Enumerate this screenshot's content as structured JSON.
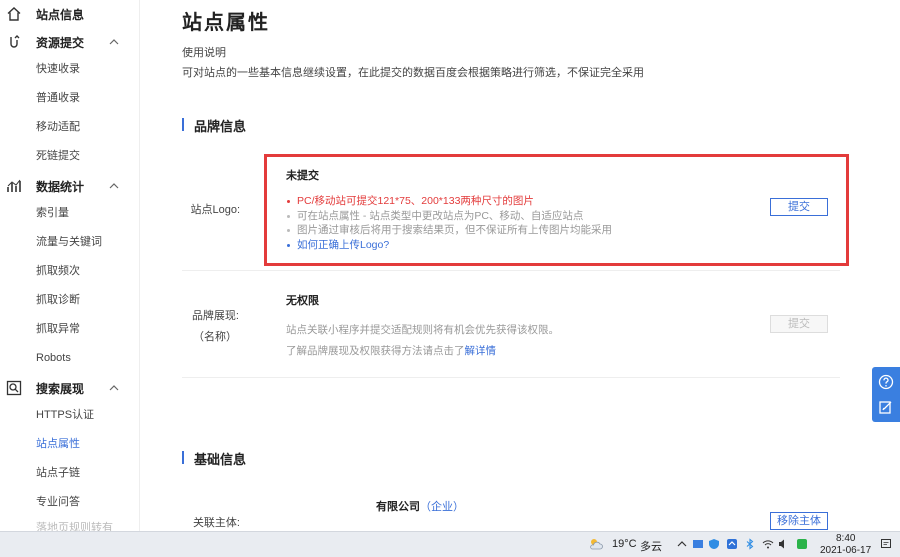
{
  "sidebar": {
    "groups": [
      {
        "label": "站点信息",
        "icon": "home-icon"
      },
      {
        "label": "资源提交",
        "icon": "submit-icon"
      },
      {
        "label": "数据统计",
        "icon": "stats-icon"
      },
      {
        "label": "搜索展现",
        "icon": "search-display-icon"
      }
    ],
    "items": [
      {
        "label": "快速收录"
      },
      {
        "label": "普通收录"
      },
      {
        "label": "移动适配"
      },
      {
        "label": "死链提交"
      },
      {
        "label": "索引量"
      },
      {
        "label": "流量与关键词"
      },
      {
        "label": "抓取频次"
      },
      {
        "label": "抓取诊断"
      },
      {
        "label": "抓取异常"
      },
      {
        "label": "Robots"
      },
      {
        "label": "HTTPS认证"
      },
      {
        "label": "站点属性"
      },
      {
        "label": "站点子链"
      },
      {
        "label": "专业问答"
      },
      {
        "label": "落地页规则转有"
      }
    ]
  },
  "main": {
    "title": "站点属性",
    "usage_title": "使用说明",
    "usage_desc": "可对站点的一些基本信息继续设置，在此提交的数据百度会根据策略进行筛选，不保证完全采用",
    "brand_section": {
      "title": "品牌信息",
      "logo_row": {
        "label": "站点Logo:",
        "status": "未提交",
        "bullets": [
          "PC/移动站可提交121*75、200*133两种尺寸的图片",
          "可在站点属性 - 站点类型中更改站点为PC、移动、自适应站点",
          "图片通过审核后将用于搜索结果页，但不保证所有上传图片均能采用",
          "如何正确上传Logo?"
        ],
        "button": "提交"
      },
      "brand_row": {
        "label_line1": "品牌展现:",
        "label_line2": "（名称）",
        "status": "无权限",
        "desc1": "站点关联小程序并提交适配规则将有机会优先获得该权限。",
        "desc2_prefix": "了解品牌展现及权限获得方法请点击了",
        "desc2_link": "解详情",
        "button": "提交"
      }
    },
    "basic_section": {
      "title": "基础信息",
      "entity_row": {
        "label": "关联主体:",
        "value": "有限公司",
        "tag": "（企业）",
        "button": "移除主体"
      }
    }
  },
  "float_tools": {
    "icons": [
      "help-icon",
      "feedback-icon"
    ]
  },
  "taskbar": {
    "temperature": "19°C",
    "condition": "多云",
    "time": "8:40",
    "date": "2021-06-17"
  },
  "colors": {
    "accent": "#3a6fd8",
    "highlight": "#e33b3b"
  }
}
